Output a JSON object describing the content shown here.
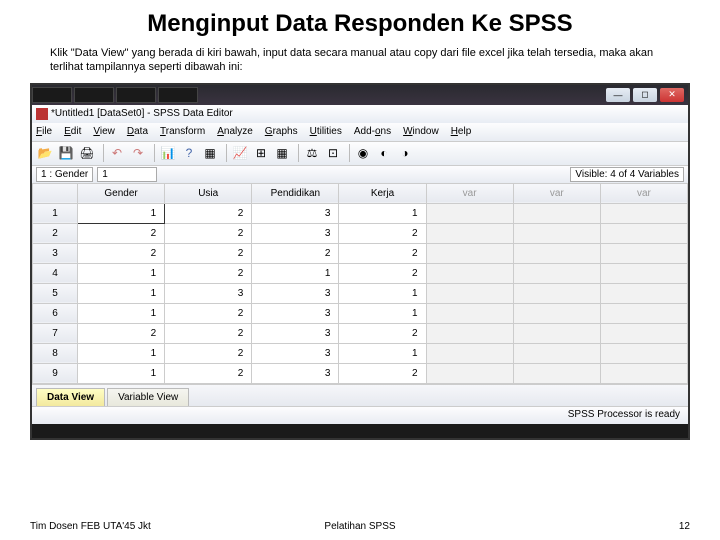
{
  "slide": {
    "title": "Menginput Data Responden Ke SPSS",
    "desc": "Klik \"Data View\" yang berada di kiri bawah, input data secara manual atau copy dari file excel jika telah tersedia, maka akan terlihat tampilannya seperti dibawah ini:"
  },
  "window": {
    "title": "*Untitled1 [DataSet0] - SPSS Data Editor",
    "min": "—",
    "max": "◻",
    "close": "✕"
  },
  "menu": {
    "file": "File",
    "edit": "Edit",
    "view": "View",
    "data": "Data",
    "transform": "Transform",
    "analyze": "Analyze",
    "graphs": "Graphs",
    "utilities": "Utilities",
    "addons": "Add-ons",
    "window": "Window",
    "help": "Help"
  },
  "info": {
    "cellref": "1 : Gender",
    "cellval": "1",
    "visible": "Visible: 4 of 4 Variables"
  },
  "columns": [
    "Gender",
    "Usia",
    "Pendidikan",
    "Kerja",
    "var",
    "var",
    "var"
  ],
  "data": [
    {
      "row": "1",
      "v": [
        "1",
        "2",
        "3",
        "1"
      ]
    },
    {
      "row": "2",
      "v": [
        "2",
        "2",
        "3",
        "2"
      ]
    },
    {
      "row": "3",
      "v": [
        "2",
        "2",
        "2",
        "2"
      ]
    },
    {
      "row": "4",
      "v": [
        "1",
        "2",
        "1",
        "2"
      ]
    },
    {
      "row": "5",
      "v": [
        "1",
        "3",
        "3",
        "1"
      ]
    },
    {
      "row": "6",
      "v": [
        "1",
        "2",
        "3",
        "1"
      ]
    },
    {
      "row": "7",
      "v": [
        "2",
        "2",
        "3",
        "2"
      ]
    },
    {
      "row": "8",
      "v": [
        "1",
        "2",
        "3",
        "1"
      ]
    },
    {
      "row": "9",
      "v": [
        "1",
        "2",
        "3",
        "2"
      ]
    }
  ],
  "tabs": {
    "dataview": "Data View",
    "varview": "Variable View"
  },
  "status": "SPSS Processor is ready",
  "footer": {
    "left": "Tim Dosen FEB UTA'45 Jkt",
    "center": "Pelatihan SPSS",
    "page": "12"
  }
}
